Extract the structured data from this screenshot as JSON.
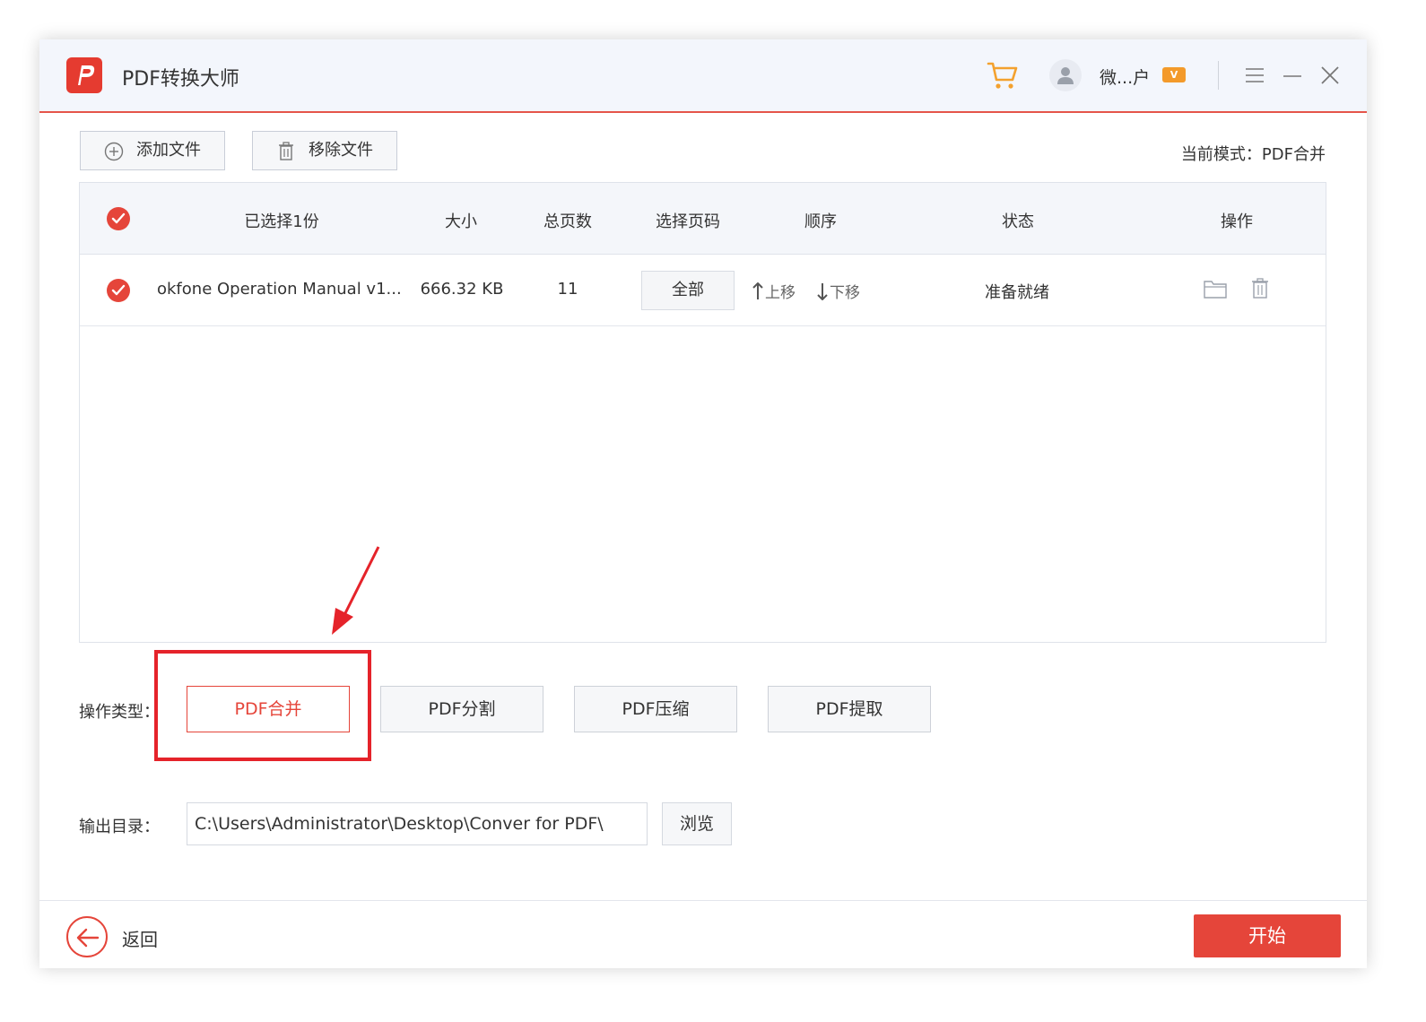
{
  "window": {
    "title": "PDF转换大师",
    "user_name": "微...户",
    "vip_badge": "V",
    "accent_color": "#e5453a"
  },
  "toolbar": {
    "add_file_label": "添加文件",
    "remove_file_label": "移除文件",
    "current_mode": "当前模式：PDF合并"
  },
  "table": {
    "headers": {
      "selected": "已选择1份",
      "size": "大小",
      "pages": "总页数",
      "select_pages": "选择页码",
      "order": "顺序",
      "status": "状态",
      "actions": "操作"
    },
    "rows": [
      {
        "name": "okfone Operation Manual v1...",
        "size": "666.32 KB",
        "pages": "11",
        "page_select": "全部",
        "move_up": "上移",
        "move_down": "下移",
        "status": "准备就绪"
      }
    ]
  },
  "operation": {
    "label": "操作类型：",
    "options": [
      "PDF合并",
      "PDF分割",
      "PDF压缩",
      "PDF提取"
    ],
    "selected": "PDF合并"
  },
  "output": {
    "label": "输出目录：",
    "path": "C:\\Users\\Administrator\\Desktop\\Conver for PDF\\",
    "browse_label": "浏览"
  },
  "footer": {
    "back_label": "返回",
    "start_label": "开始"
  }
}
